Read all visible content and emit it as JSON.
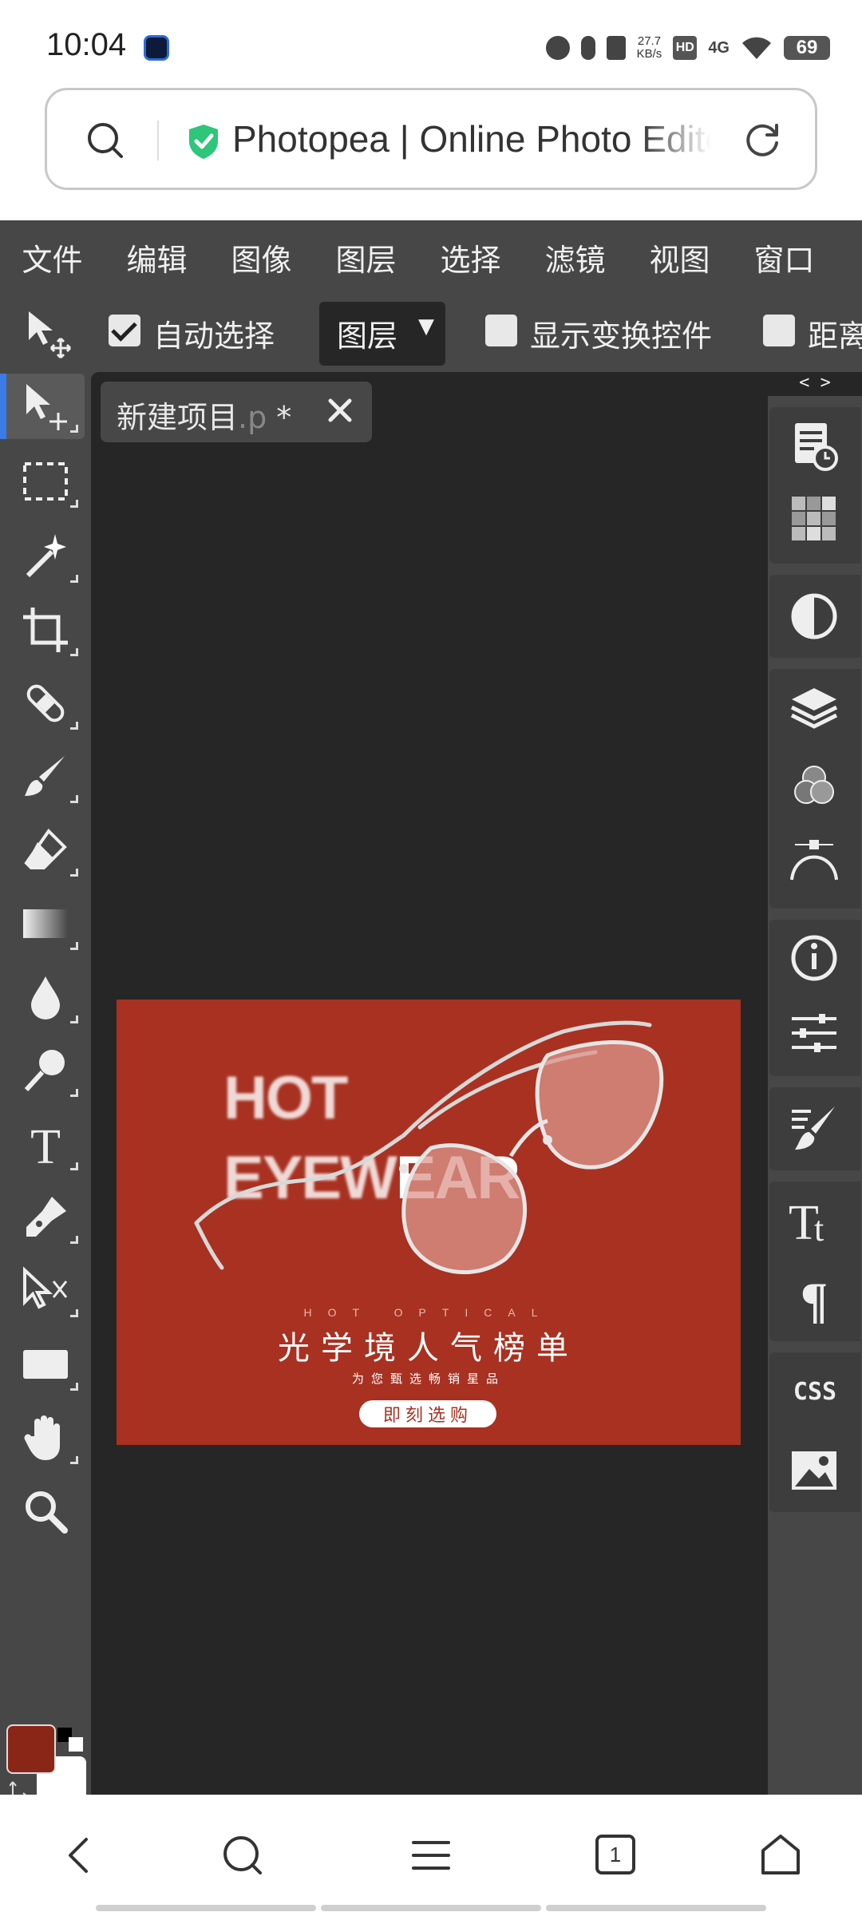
{
  "status_bar": {
    "time": "10:04",
    "speed_value": "27.7",
    "speed_unit": "KB/s",
    "network": "4G",
    "hd": "HD",
    "battery": "69"
  },
  "address_bar": {
    "title": "Photopea | Online Photo Editor"
  },
  "menu": {
    "items": [
      "文件",
      "编辑",
      "图像",
      "图层",
      "选择",
      "滤镜",
      "视图",
      "窗口"
    ]
  },
  "options": {
    "auto_select_label": "自动选择",
    "auto_select_checked": true,
    "target_dropdown_value": "图层",
    "dropdown_arrow": "▼",
    "show_transform_label": "显示变换控件",
    "distance_label": "距离"
  },
  "document": {
    "tab_name": "新建项目",
    "tab_ext": ".p",
    "tab_modified": " *"
  },
  "poster": {
    "hot": "HOT",
    "eyewear_a": "EYEW",
    "eyewear_b": "EAR",
    "sub_en": "HOT OPTICAL",
    "title": "光学境人气榜单",
    "sub_cn": "为您甄选畅销星品",
    "button": "即刻选购",
    "background_color": "#a83121"
  },
  "right_panel": {
    "collapse_label": "< >",
    "css_label": "CSS"
  },
  "colors": {
    "foreground": "#8a2618",
    "background": "#ffffff",
    "accent": "#3b7be8"
  },
  "bottom_nav": {
    "tabs_count": "1"
  }
}
